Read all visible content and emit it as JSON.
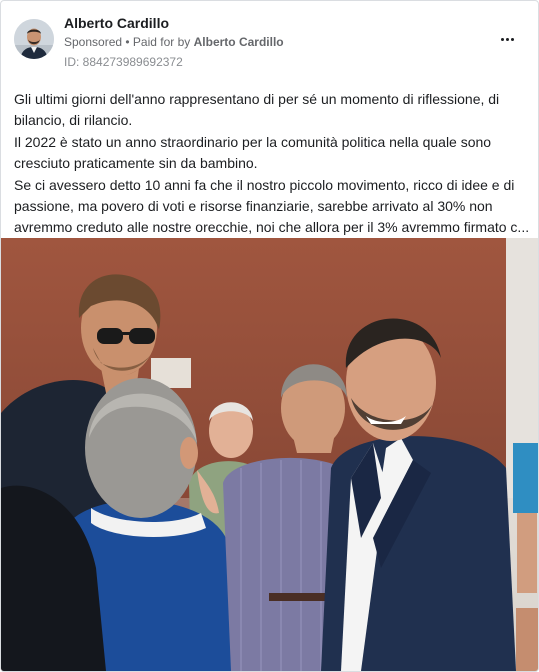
{
  "post": {
    "author": "Alberto Cardillo",
    "sponsored_label": "Sponsored",
    "paid_prefix": " • Paid for by ",
    "paid_by": "Alberto Cardillo",
    "ad_id": "ID: 884273989692372",
    "body_lines": [
      "Gli ultimi giorni dell'anno rappresentano di per sé un momento di riflessione, di",
      "bilancio, di rilancio.",
      "Il 2022 è stato un anno straordinario per la comunità politica nella quale sono",
      "cresciuto praticamente sin da bambino.",
      "Se ci avessero detto 10 anni fa che il nostro piccolo movimento, ricco di idee e di",
      "passione, ma povero di voti e risorse finanziarie, sarebbe arrivato al 30% non",
      "avremmo creduto alle nostre orecchie, noi che allora per il 3% avremmo firmato c..."
    ]
  },
  "icons": {
    "more": "more-options-icon"
  }
}
